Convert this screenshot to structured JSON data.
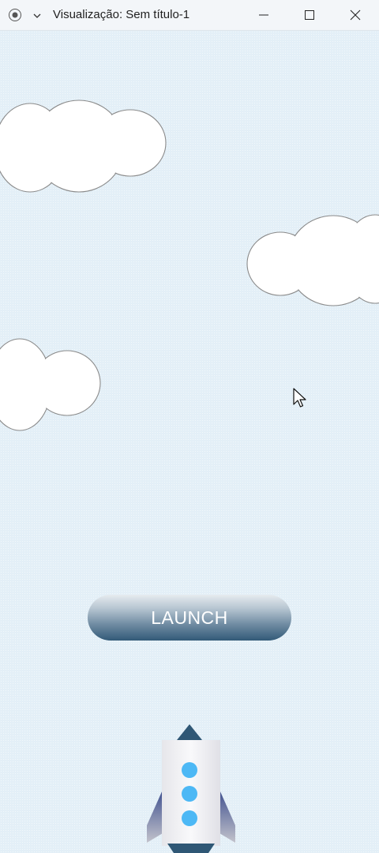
{
  "window": {
    "title": "Visualização: Sem título-1",
    "controls": {
      "record_icon": "record-icon",
      "menu_icon": "chevron-down-icon",
      "minimize_icon": "minimize-icon",
      "maximize_icon": "maximize-icon",
      "close_icon": "close-icon"
    }
  },
  "scene": {
    "sky_color": "#e3eff7",
    "clouds": 3,
    "launch_button": {
      "label": "LAUNCH",
      "gradient_top": "#e6ebef",
      "gradient_bottom": "#325a78"
    },
    "rocket": {
      "window_color": "#4db8f5",
      "nose_color": "#2f5775",
      "body_color": "#f4f4f6",
      "fin_color": "#5d6fa6"
    }
  }
}
